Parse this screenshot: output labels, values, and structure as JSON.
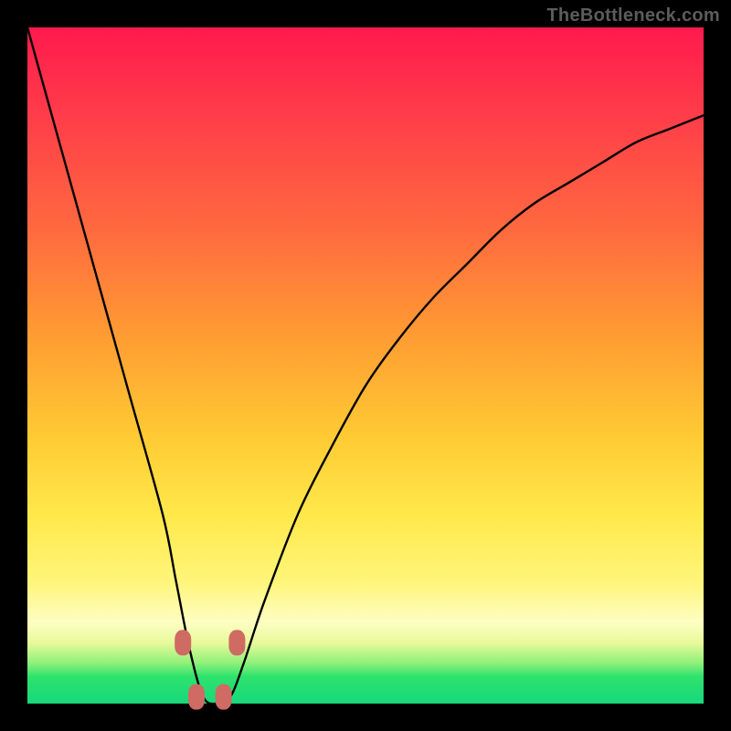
{
  "watermark": "TheBottleneck.com",
  "colors": {
    "frame": "#000000",
    "curve": "#000000",
    "marker": "#cf6b63",
    "gradient_top": "#ff1a4d",
    "gradient_mid1": "#ff9a33",
    "gradient_mid2": "#ffe84a",
    "gradient_bottom": "#17d87b"
  },
  "chart_data": {
    "type": "line",
    "title": "",
    "xlabel": "",
    "ylabel": "",
    "xlim": [
      0,
      100
    ],
    "ylim": [
      0,
      100
    ],
    "series": [
      {
        "name": "bottleneck-curve",
        "x": [
          0,
          5,
          10,
          15,
          20,
          22,
          24,
          26,
          28,
          30,
          32,
          35,
          40,
          45,
          50,
          55,
          60,
          65,
          70,
          75,
          80,
          85,
          90,
          95,
          100
        ],
        "values": [
          100,
          82,
          64,
          46,
          28,
          18,
          8,
          1,
          0,
          1,
          6,
          15,
          28,
          38,
          47,
          54,
          60,
          65,
          70,
          74,
          77,
          80,
          83,
          85,
          87
        ]
      }
    ],
    "annotations": {
      "markers_desc": "four salmon rounded blobs near curve minimum",
      "marker_points": [
        {
          "x": 23,
          "y": 9
        },
        {
          "x": 31,
          "y": 9
        },
        {
          "x": 25,
          "y": 1
        },
        {
          "x": 29,
          "y": 1
        }
      ]
    }
  }
}
